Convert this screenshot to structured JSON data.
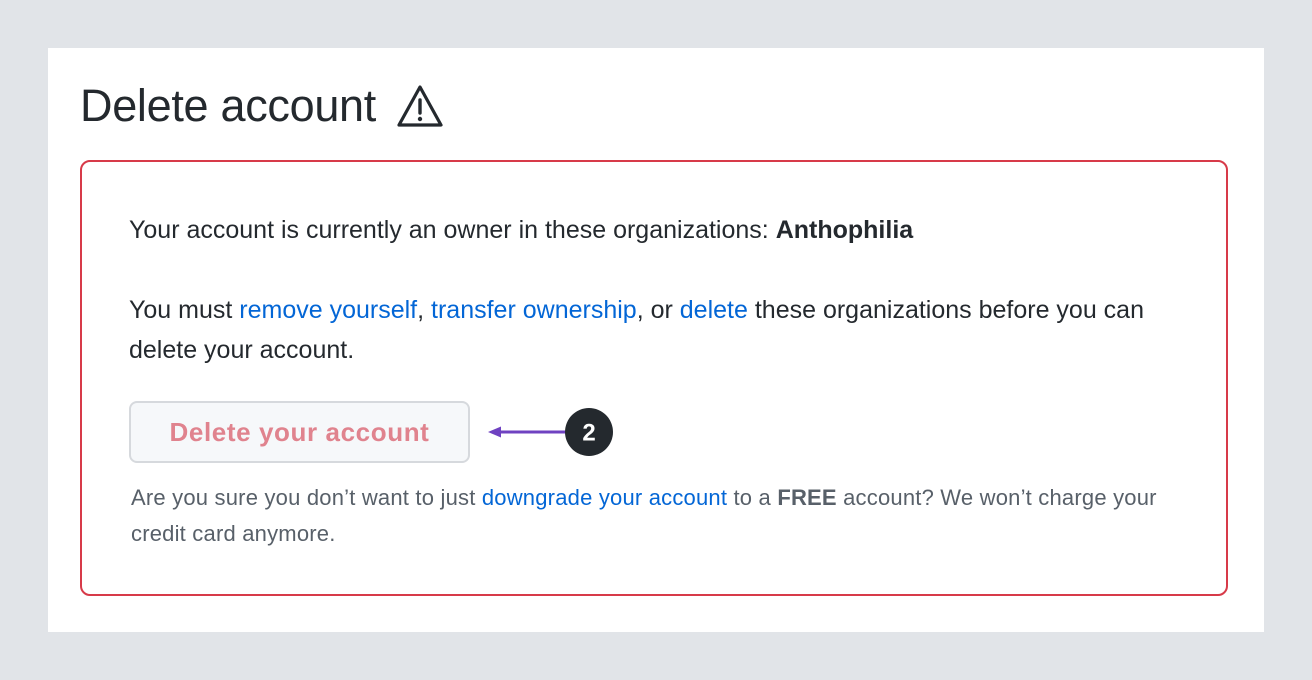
{
  "page": {
    "title": "Delete account",
    "title_icon": "warning-icon"
  },
  "danger_zone": {
    "owner_text": "Your account is currently an owner in these organizations:",
    "organization": "Anthophilia",
    "must_prefix": "You must",
    "remove_link": "remove yourself",
    "separator_1": ",",
    "transfer_link": "transfer ownership",
    "separator_2": ", or",
    "delete_link": "delete",
    "must_suffix": "these organizations before you can delete your account.",
    "delete_button_label": "Delete your account",
    "delete_button_disabled": true,
    "note_prefix": "Are you sure you don’t want to just",
    "downgrade_link": "downgrade your account",
    "note_middle": "to a",
    "free_label": "FREE",
    "note_suffix": "account? We won’t charge your credit card anymore."
  },
  "annotation": {
    "step_number": "2",
    "arrow_color": "#6f42c1",
    "badge_color": "#24292e"
  },
  "colors": {
    "background": "#e1e4e8",
    "card": "#ffffff",
    "danger_border": "#d73a49",
    "link": "#0366d6",
    "disabled_danger_text": "#e0838e"
  }
}
